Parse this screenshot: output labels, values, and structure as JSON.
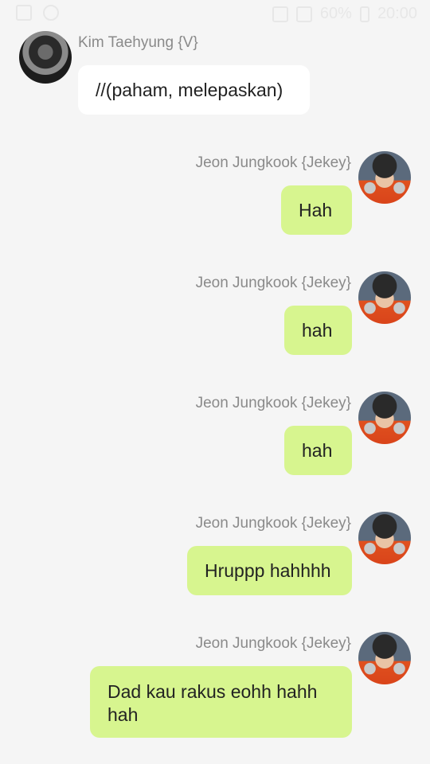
{
  "status_bar": {
    "battery": "60%",
    "time": "20:00"
  },
  "messages": [
    {
      "sender": "Kim Taehyung {V}",
      "text": "//(paham, melepaskan)",
      "side": "left"
    },
    {
      "sender": "Jeon Jungkook {Jekey}",
      "text": "Hah",
      "side": "right"
    },
    {
      "sender": "Jeon Jungkook {Jekey}",
      "text": "hah",
      "side": "right"
    },
    {
      "sender": "Jeon Jungkook {Jekey}",
      "text": "hah",
      "side": "right"
    },
    {
      "sender": "Jeon Jungkook {Jekey}",
      "text": "Hruppp hahhhh",
      "side": "right"
    },
    {
      "sender": "Jeon Jungkook {Jekey}",
      "text": "Dad kau rakus eohh hahh hah",
      "side": "right"
    }
  ],
  "colors": {
    "background": "#f5f5f5",
    "incoming_bubble": "#ffffff",
    "outgoing_bubble": "#d7f58f",
    "sender_name": "#8a8a8a"
  }
}
